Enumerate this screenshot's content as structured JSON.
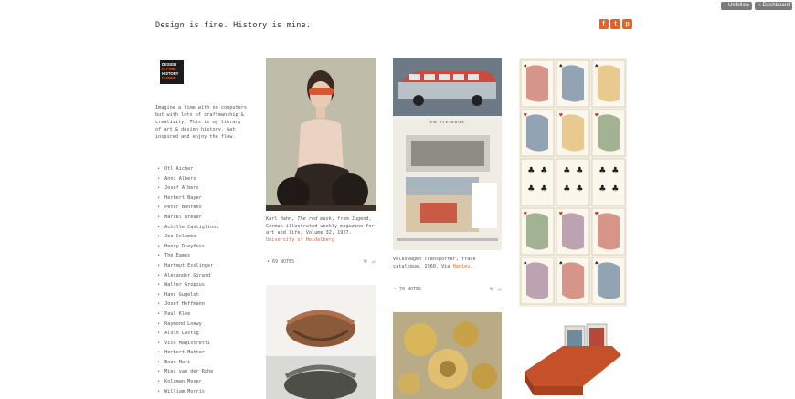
{
  "controls": {
    "unfollow": "Unfollow",
    "dashboard": "Dashboard"
  },
  "header": {
    "title": "Design is fine. History is mine."
  },
  "share": {
    "facebook": "f",
    "twitter": "t",
    "pinterest": "p"
  },
  "logo": {
    "line1": "DESIGN",
    "line2": "IS FINE.",
    "line3": "HISTORY",
    "line4": "IS MINE"
  },
  "intro": "Imagine a time with no computers but with lots of craftmanship & creativity. This is my library of art & design history. Get inspired and enjoy the flow.",
  "people": [
    "Otl Aicher",
    "Anni Albers",
    "Josef Albers",
    "Herbert Bayer",
    "Peter Behrens",
    "Marcel Breuer",
    "Achille Castiglioni",
    "Joe Colombo",
    "Henry Dreyfuss",
    "The Eames",
    "Hartmut Esslinger",
    "Alexander Girard",
    "Walter Gropius",
    "Hans Gugelot",
    "Josef Hoffmann",
    "Paul Klee",
    "Raymond Loewy",
    "Alvin Lustig",
    "Vico Magistretti",
    "Herbert Matter",
    "Enzo Mari",
    "Mies van der Rohe",
    "Koloman Moser",
    "William Morris"
  ],
  "posts": {
    "p1": {
      "caption_pre": "Karl Hahn, ",
      "caption_em": "The red mask",
      "caption_post": ", from Jugend, German illustrated weekly magazine for art and life, Volume 32, 1927.",
      "caption_link": "University of Heidelberg",
      "notes": "• 69 NOTES"
    },
    "p2": {
      "header": "VW KLEINBUS",
      "caption": "Volkswagen Transporter, trade catalogue, 1960. Via ",
      "caption_link": "Hagley",
      "caption_end": ".",
      "notes": "• 70 NOTES"
    }
  },
  "colors": {
    "accent": "#e0642a",
    "button_grey": "#7a7a7a"
  }
}
